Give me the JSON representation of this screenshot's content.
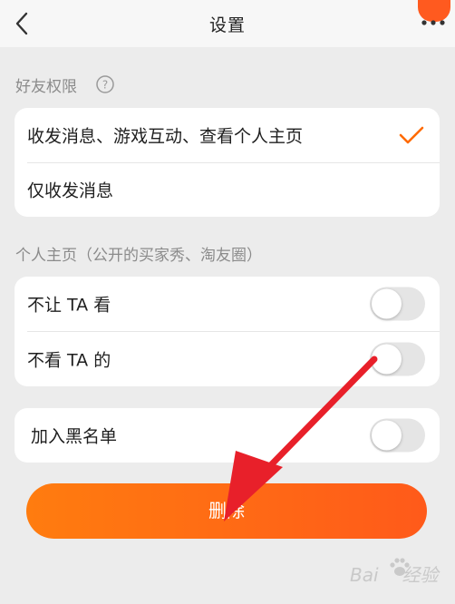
{
  "header": {
    "title": "设置",
    "back_icon": "chevron-left-icon",
    "more_icon": "more-dots-icon",
    "accent_color": "#ff5a1f"
  },
  "friend_permission": {
    "section_label": "好友权限",
    "help_icon": "question-circle-icon",
    "options": [
      {
        "label": "收发消息、游戏互动、查看个人主页",
        "selected": true
      },
      {
        "label": "仅收发消息",
        "selected": false
      }
    ],
    "check_color": "#ff6a00"
  },
  "homepage": {
    "section_label": "个人主页（公开的买家秀、淘友圈）",
    "toggles": [
      {
        "label": "不让 TA 看",
        "on": false
      },
      {
        "label": "不看 TA 的",
        "on": false
      }
    ]
  },
  "blacklist": {
    "label": "加入黑名单",
    "on": false
  },
  "delete_button": {
    "label": "删除",
    "gradient": [
      "#ff7c0f",
      "#ff5a1a"
    ]
  },
  "annotation_arrow_color": "#e8202a",
  "watermark": {
    "text_left": "Bai",
    "text_right": "经验"
  }
}
